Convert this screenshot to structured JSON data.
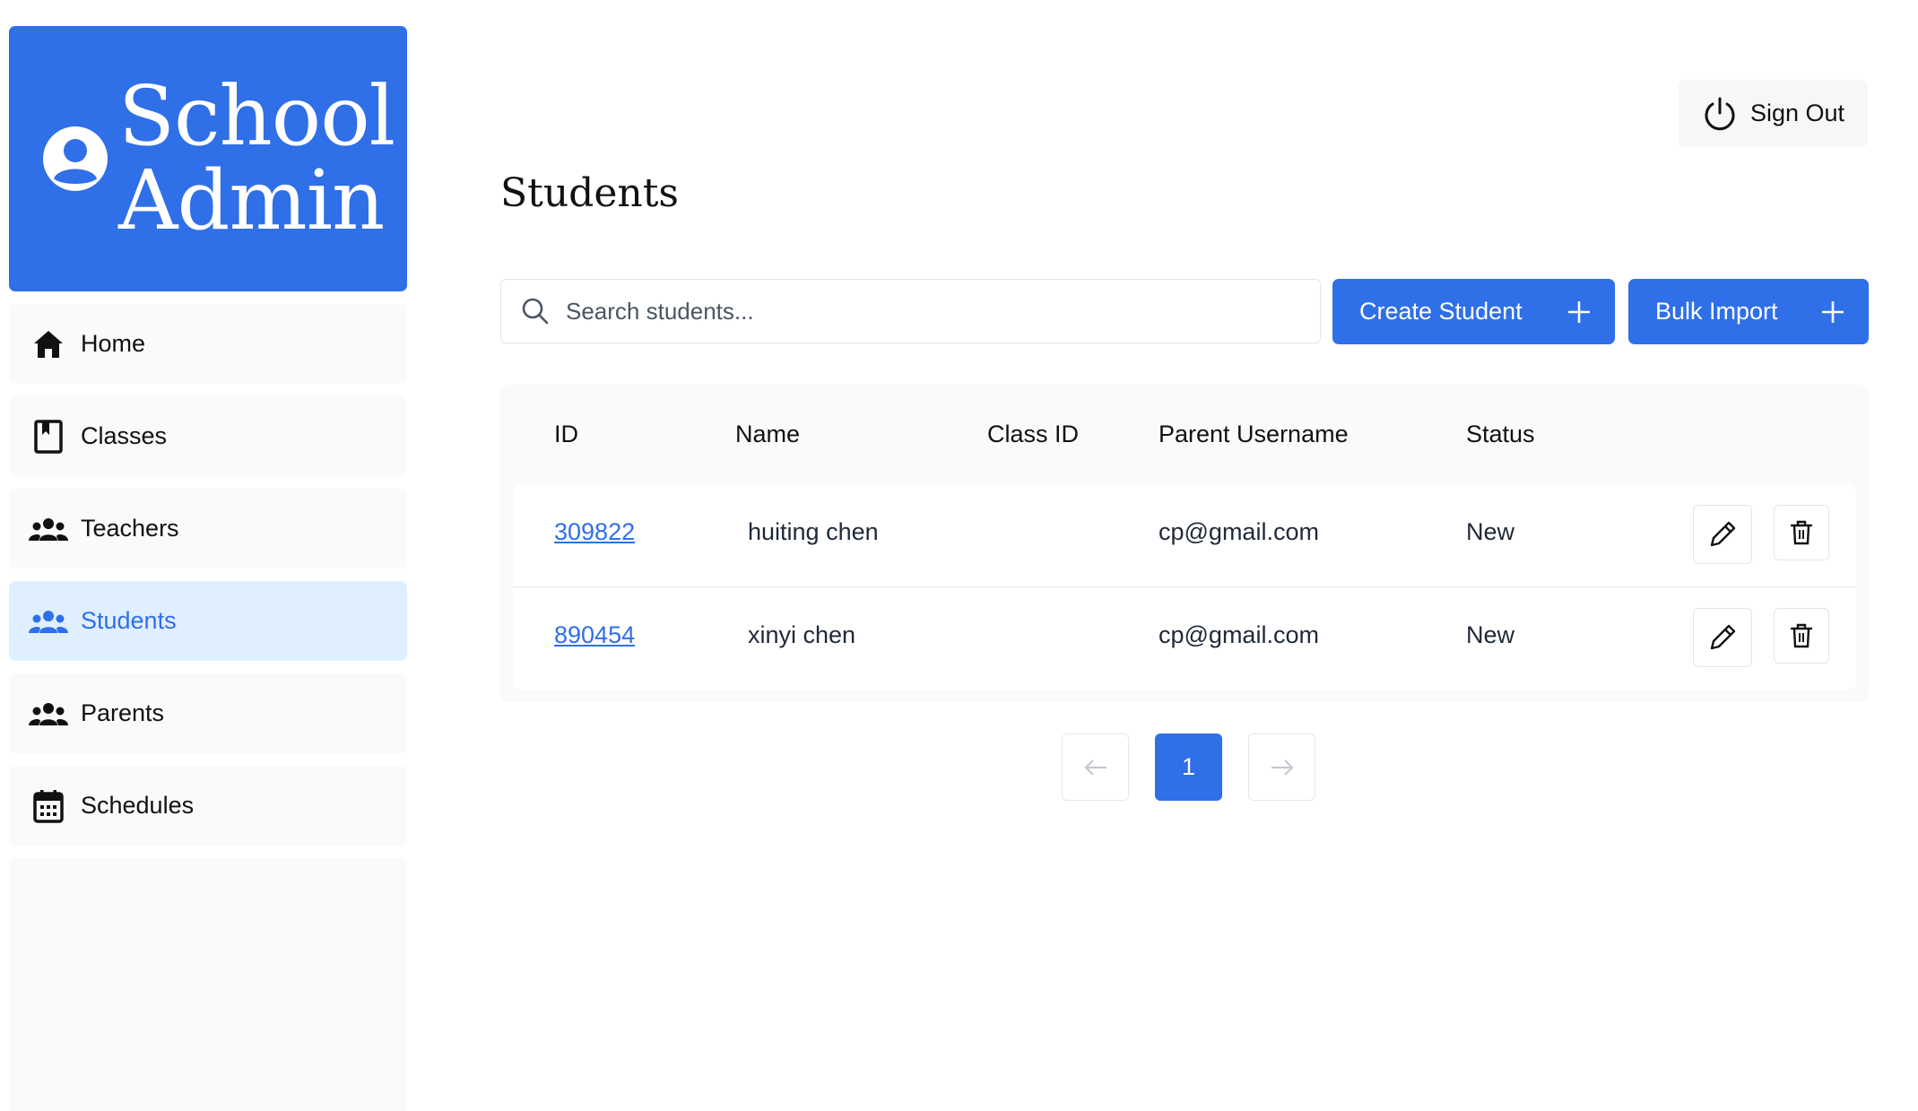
{
  "brand": {
    "line1": "School",
    "line2": "Admin",
    "icon": "user-circle-icon"
  },
  "sidebar": {
    "items": [
      {
        "label": "Home",
        "icon": "home-icon",
        "active": false
      },
      {
        "label": "Classes",
        "icon": "bookmark-book-icon",
        "active": false
      },
      {
        "label": "Teachers",
        "icon": "people-group-icon",
        "active": false
      },
      {
        "label": "Students",
        "icon": "people-group-icon",
        "active": true
      },
      {
        "label": "Parents",
        "icon": "people-group-icon",
        "active": false
      },
      {
        "label": "Schedules",
        "icon": "calendar-icon",
        "active": false
      }
    ]
  },
  "header": {
    "signout_label": "Sign Out",
    "signout_icon": "power-icon"
  },
  "page": {
    "title": "Students"
  },
  "search": {
    "placeholder": "Search students...",
    "value": ""
  },
  "actions": {
    "create_label": "Create Student",
    "bulk_label": "Bulk Import"
  },
  "table": {
    "columns": [
      "ID",
      "Name",
      "Class ID",
      "Parent Username",
      "Status"
    ],
    "rows": [
      {
        "id": "309822",
        "name": "huiting chen",
        "class_id": "",
        "parent": "cp@gmail.com",
        "status": "New"
      },
      {
        "id": "890454",
        "name": "xinyi chen",
        "class_id": "",
        "parent": "cp@gmail.com",
        "status": "New"
      }
    ]
  },
  "pagination": {
    "current": "1"
  },
  "colors": {
    "primary": "#2f6fe8",
    "active_bg": "#e0efff",
    "panel_bg": "#f8fafc"
  }
}
